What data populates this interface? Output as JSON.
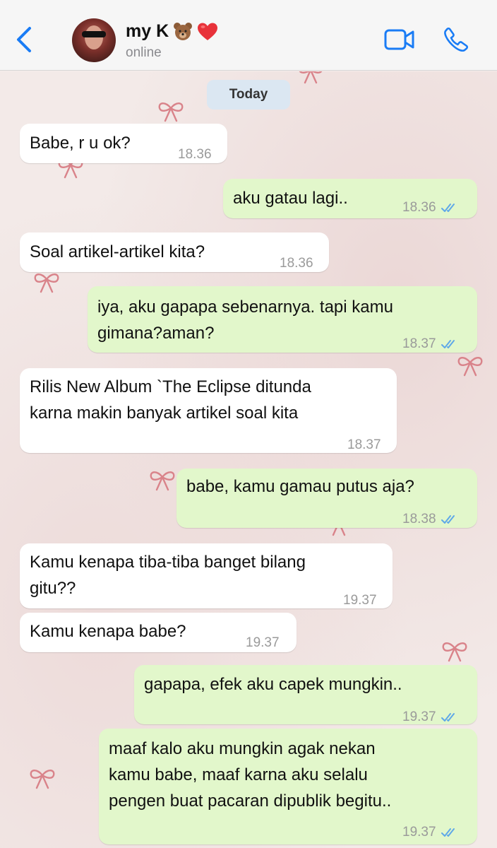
{
  "header": {
    "back_label": "",
    "contact_name": "my K",
    "status": "online"
  },
  "chat": {
    "date_chip": "Today",
    "messages": [
      {
        "dir": "in",
        "text": "Babe, r u ok?",
        "time": "18.36"
      },
      {
        "dir": "out",
        "text": "aku gatau lagi..",
        "time": "18.36"
      },
      {
        "dir": "in",
        "text": "Soal artikel-artikel kita?",
        "time": "18.36"
      },
      {
        "dir": "out",
        "text": "iya, aku gapapa sebenarnya. tapi kamu\ngimana?aman?",
        "time": "18.37"
      },
      {
        "dir": "in",
        "text": "Rilis New Album `The Eclipse ditunda\nkarna makin banyak artikel soal kita",
        "time": "18.37"
      },
      {
        "dir": "out",
        "text": "babe, kamu gamau putus aja?",
        "time": "18.38"
      },
      {
        "dir": "in",
        "text": "Kamu kenapa tiba-tiba banget bilang\ngitu??",
        "time": "19.37"
      },
      {
        "dir": "in",
        "text": "Kamu kenapa babe?",
        "time": "19.37"
      },
      {
        "dir": "out",
        "text": "gapapa, efek aku capek mungkin..",
        "time": "19.37"
      },
      {
        "dir": "out",
        "text": "maaf kalo aku mungkin agak nekan\nkamu babe, maaf karna aku selalu\npengen buat pacaran dipublik begitu..",
        "time": "19.37"
      }
    ]
  },
  "colors": {
    "accent": "#1a7cf5",
    "incoming_bubble": "#ffffff",
    "outgoing_bubble": "#e2f7cb",
    "read_ticks": "#5fa8e8",
    "date_chip": "#dbe7f2",
    "bow": "#d9838a"
  },
  "icons": [
    "back-chevron-icon",
    "video-call-icon",
    "phone-icon",
    "bear-emoji-icon",
    "heart-emoji-icon",
    "read-ticks-icon",
    "ribbon-bow-icon"
  ]
}
